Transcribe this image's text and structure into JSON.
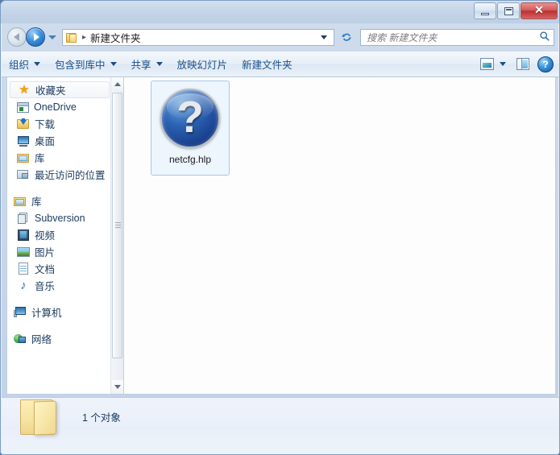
{
  "window": {
    "title": "",
    "buttons": {
      "minimize": "minimize",
      "maximize": "maximize",
      "close": "✕"
    }
  },
  "navbar": {
    "back_label": "后退",
    "forward_label": "前进",
    "history_label": "最近浏览的位置",
    "breadcrumb_separator": "▸",
    "breadcrumb": "新建文件夹",
    "refresh_label": "↻",
    "search": {
      "placeholder": "搜索 新建文件夹",
      "icon": "search-icon",
      "value": ""
    }
  },
  "toolbar": {
    "items": [
      {
        "label": "组织",
        "has_caret": true
      },
      {
        "label": "包含到库中",
        "has_caret": true
      },
      {
        "label": "共享",
        "has_caret": true
      },
      {
        "label": "放映幻灯片",
        "has_caret": false
      },
      {
        "label": "新建文件夹",
        "has_caret": false
      }
    ],
    "view_label": "更改您的视图",
    "preview_label": "显示预览窗格",
    "help_label": "?"
  },
  "sidebar": {
    "groups": [
      {
        "header": {
          "label": "收藏夹",
          "icon": "star-icon",
          "selected": true
        },
        "items": [
          {
            "label": "OneDrive",
            "icon": "onedrive-icon"
          },
          {
            "label": "下载",
            "icon": "downloads-icon"
          },
          {
            "label": "桌面",
            "icon": "desktop-icon"
          },
          {
            "label": "库",
            "icon": "library-icon"
          },
          {
            "label": "最近访问的位置",
            "icon": "recent-places-icon"
          }
        ]
      },
      {
        "header": {
          "label": "库",
          "icon": "library-icon",
          "selected": false
        },
        "items": [
          {
            "label": "Subversion",
            "icon": "subversion-icon"
          },
          {
            "label": "视频",
            "icon": "videos-icon"
          },
          {
            "label": "图片",
            "icon": "pictures-icon"
          },
          {
            "label": "文档",
            "icon": "documents-icon"
          },
          {
            "label": "音乐",
            "icon": "music-icon"
          }
        ]
      },
      {
        "header": {
          "label": "计算机",
          "icon": "computer-icon",
          "selected": false
        },
        "items": []
      },
      {
        "header": {
          "label": "网络",
          "icon": "network-icon",
          "selected": false
        },
        "items": []
      }
    ]
  },
  "content": {
    "files": [
      {
        "name": "netcfg.hlp",
        "icon": "help-file-icon",
        "selected": true
      }
    ]
  },
  "statusbar": {
    "folder_icon": "folder-icon",
    "text": "1 个对象"
  },
  "colors": {
    "titlebar": "#c6d5e8",
    "accent_blue": "#1b4f8a",
    "close_red": "#bb3030",
    "selection_fill": "#edf5fd",
    "selection_border": "#a8c8e8",
    "help_icon_blue": "#2d63b4",
    "folder_yellow": "#f6e3a0"
  }
}
